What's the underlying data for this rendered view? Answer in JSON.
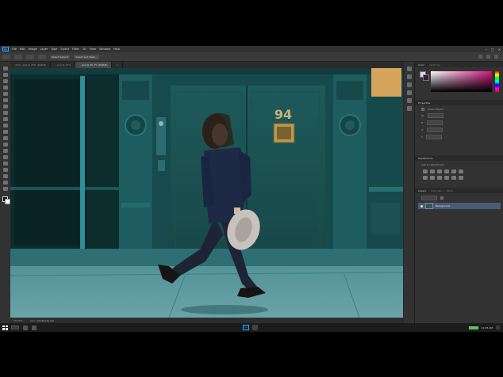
{
  "menubar": {
    "app_logo": "Ps",
    "items": [
      "File",
      "Edit",
      "Image",
      "Layer",
      "Type",
      "Select",
      "Filter",
      "3D",
      "View",
      "Window",
      "Help"
    ],
    "window_controls": [
      "–",
      "□",
      "×"
    ]
  },
  "optionsbar": {
    "buttons": [
      "Select Subject",
      "Select and Mask..."
    ]
  },
  "tabs": [
    {
      "label": "_DSC...psd @ 25% (RGB/8)",
      "active": false
    },
    {
      "label": "...psd @ 25%",
      "active": false
    },
    {
      "label": "...psd @ 20.7% (RGB/8)",
      "active": true
    },
    {
      "label": "×",
      "active": false
    }
  ],
  "canvas": {
    "door_number": "94"
  },
  "status": {
    "zoom": "20.73%",
    "doc_info": "Doc: 58.6M/146.6M"
  },
  "panels": {
    "color_tabs": [
      "Color",
      "Swatches"
    ],
    "properties_title": "Properties",
    "properties_rows": [
      "Smart Object",
      "W:",
      "H:",
      "X:",
      "Y:"
    ],
    "adjustments_title": "Adjustments",
    "adjustments_subtitle": "Add an adjustment",
    "layers_tabs": [
      "Layers",
      "Channels",
      "Paths"
    ],
    "layer_name": "Background"
  },
  "taskbar": {
    "app_label": "Ps",
    "time": "12:25 AM"
  },
  "colors": {
    "wall": "#1f5a5c",
    "accent": "#31a8ff"
  }
}
